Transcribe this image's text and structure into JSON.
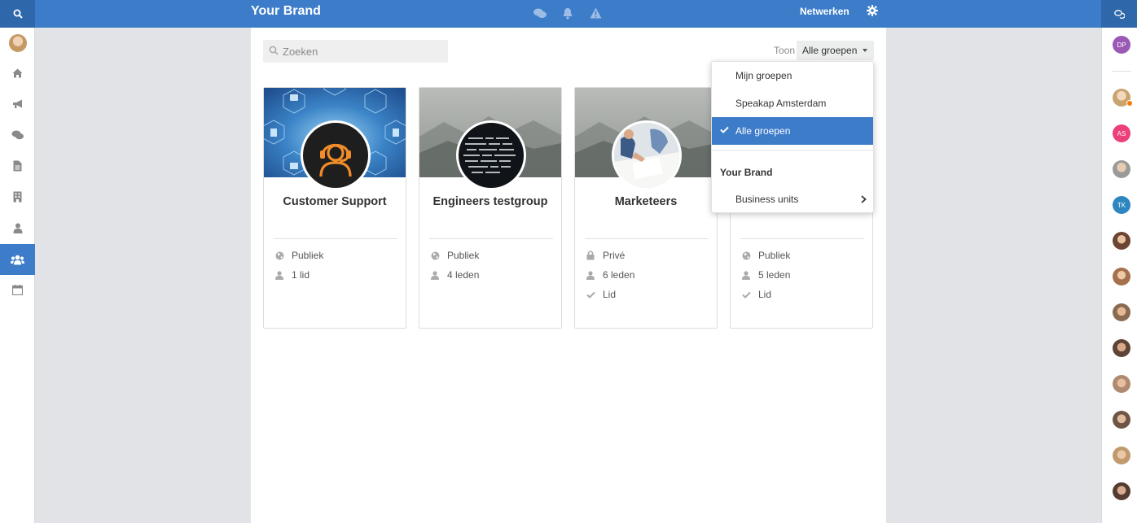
{
  "topbar": {
    "brand": "Your Brand",
    "network_label": "Netwerken"
  },
  "search": {
    "placeholder": "Zoeken"
  },
  "filter": {
    "label": "Toon",
    "selected": "Alle groepen",
    "options": [
      "Mijn groepen",
      "Speakap Amsterdam",
      "Alle groepen"
    ],
    "section_title": "Your Brand",
    "submenu": "Business units"
  },
  "groups": [
    {
      "name": "Customer Support",
      "visibility": "Publiek",
      "members": "1 lid",
      "membership": ""
    },
    {
      "name": "Engineers testgroup",
      "visibility": "Publiek",
      "members": "4 leden",
      "membership": ""
    },
    {
      "name": "Marketeers",
      "visibility": "Privé",
      "members": "6 leden",
      "membership": "Lid"
    },
    {
      "name": "",
      "visibility": "Publiek",
      "members": "5 leden",
      "membership": "Lid"
    }
  ],
  "rightbar": {
    "initials": [
      "DP",
      "AS",
      "TK"
    ]
  },
  "colors": {
    "primary": "#3d7cc9",
    "primary_dark": "#2f67ab",
    "avatar_dp": "#9b59b6",
    "avatar_as": "#ec407a",
    "avatar_tk": "#2e86c1",
    "status_away": "#f57c00"
  }
}
